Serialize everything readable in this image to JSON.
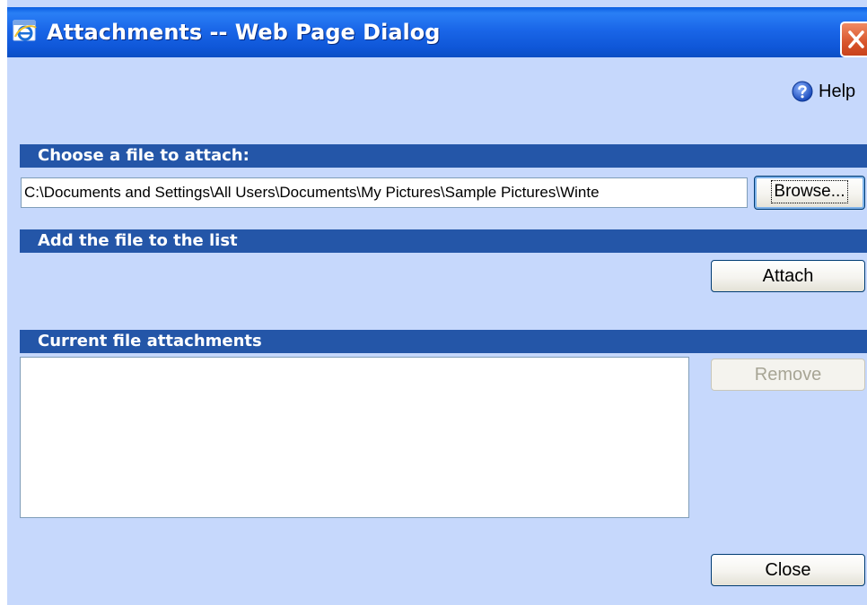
{
  "window": {
    "title": "Attachments -- Web Page Dialog",
    "icon": "ie-icon",
    "close_icon": "close-icon"
  },
  "help": {
    "label": "Help",
    "icon": "help-icon"
  },
  "sections": {
    "choose_file": "Choose a file to attach:",
    "add_file": "Add the file to the list",
    "current_attachments": "Current file attachments"
  },
  "file_input": {
    "value": "C:\\Documents and Settings\\All Users\\Documents\\My Pictures\\Sample Pictures\\Winte"
  },
  "buttons": {
    "browse": "Browse...",
    "attach": "Attach",
    "remove": "Remove",
    "close": "Close"
  },
  "attachments": [],
  "colors": {
    "background": "#c6d8fc",
    "section_bar": "#2456a8",
    "titlebar": "#0f57d8"
  }
}
